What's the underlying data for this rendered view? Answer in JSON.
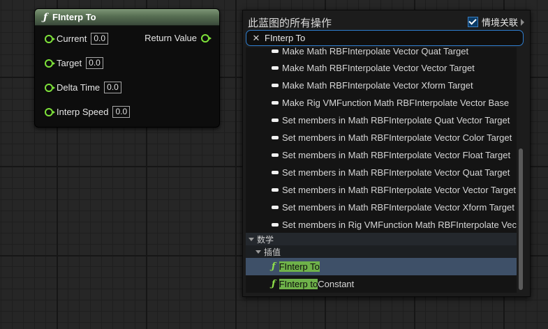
{
  "node": {
    "title": "FInterp To",
    "func_icon": "ƒ",
    "return_label": "Return Value",
    "inputs": [
      {
        "label": "Current",
        "value": "0.0"
      },
      {
        "label": "Target",
        "value": "0.0"
      },
      {
        "label": "Delta Time",
        "value": "0.0"
      },
      {
        "label": "Interp Speed",
        "value": "0.0"
      }
    ],
    "pin_color": "#7ee23a",
    "header_color": "#566e52"
  },
  "menu": {
    "title": "此蓝图的所有操作",
    "context_sensitive_label": "情境关联",
    "context_sensitive_checked": true,
    "search_value": "FInterp To",
    "items": [
      "Make Math RBFInterpolate Vector Quat Target",
      "Make Math RBFInterpolate Vector Vector Target",
      "Make Math RBFInterpolate Vector Xform Target",
      "Make Rig VMFunction Math RBFInterpolate Vector Base",
      "Set members in Math RBFInterpolate Quat Vector Target",
      "Set members in Math RBFInterpolate Vector Color Target",
      "Set members in Math RBFInterpolate Vector Float Target",
      "Set members in Math RBFInterpolate Vector Quat Target",
      "Set members in Math RBFInterpolate Vector Vector Target",
      "Set members in Math RBFInterpolate Vector Xform Target",
      "Set members in Rig VMFunction Math RBFInterpolate Vect"
    ],
    "category": "数学",
    "subcategory": "插值",
    "results": [
      {
        "match": "FInterp To",
        "rest": ""
      },
      {
        "match": "FInterp to",
        "rest": " Constant"
      }
    ],
    "accent_color": "#2f7fd1",
    "highlight_color": "#6fb24a",
    "selected_color": "#3e5068"
  }
}
